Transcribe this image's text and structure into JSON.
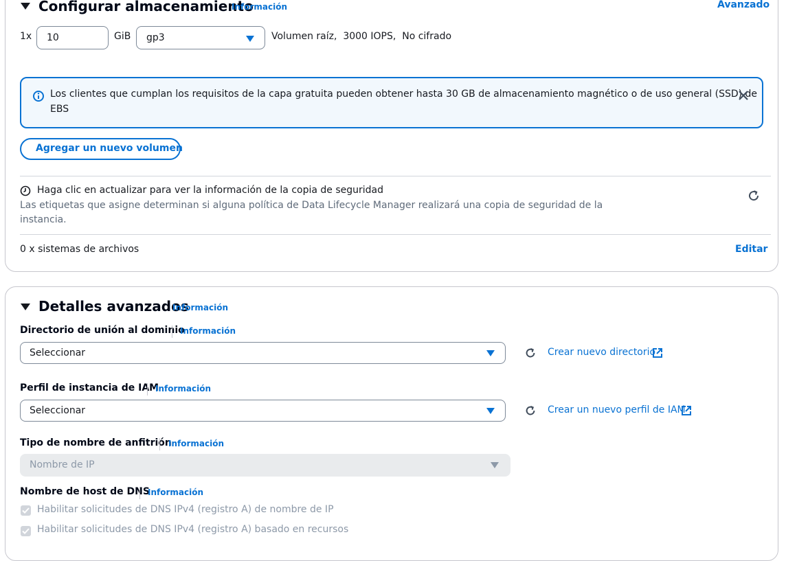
{
  "storage": {
    "title": "Configurar almacenamiento",
    "info": "Información",
    "advanced": "Avanzado",
    "multiplier": "1x",
    "size_value": "10",
    "unit": "GiB",
    "volume_type": "gp3",
    "volume_desc": "Volumen raíz,  3000 IOPS,  No cifrado",
    "alert_text_line1": "Los clientes que cumplan los requisitos de la capa gratuita pueden obtener hasta 30 GB de almacenamiento magnético o de uso general (SSD) de",
    "alert_text_line2": "EBS",
    "add_volume": "Agregar un nuevo volumen",
    "backup_title": "Haga clic en actualizar para ver la información de la copia de seguridad",
    "backup_desc_line1": "Las etiquetas que asigne determinan si alguna política de Data Lifecycle Manager realizará una copia de seguridad de la",
    "backup_desc_line2": "instancia.",
    "filesystems": "0 x sistemas de archivos",
    "edit": "Editar"
  },
  "advanced": {
    "title": "Detalles avanzados",
    "info": "Información",
    "domain_label": "Directorio de unión al dominio",
    "domain_info": "Información",
    "domain_select": "Seleccionar",
    "domain_create": "Crear nuevo directorio",
    "iam_label": "Perfil de instancia de IAM",
    "iam_info": "Información",
    "iam_select": "Seleccionar",
    "iam_create": "Crear un nuevo perfil de IAM",
    "hostname_label": "Tipo de nombre de anfitrión",
    "hostname_info": "Información",
    "hostname_placeholder": "Nombre de IP",
    "dns_label": "Nombre de host de DNS",
    "dns_info": "Información",
    "dns_cb1": "Habilitar solicitudes de DNS IPv4 (registro A) de nombre de IP",
    "dns_cb2": "Habilitar solicitudes de DNS IPv4 (registro A) basado en recursos"
  },
  "colors": {
    "link": "#0972d3",
    "alert_bg": "#f2f8fd",
    "alert_border": "#0972d3"
  }
}
